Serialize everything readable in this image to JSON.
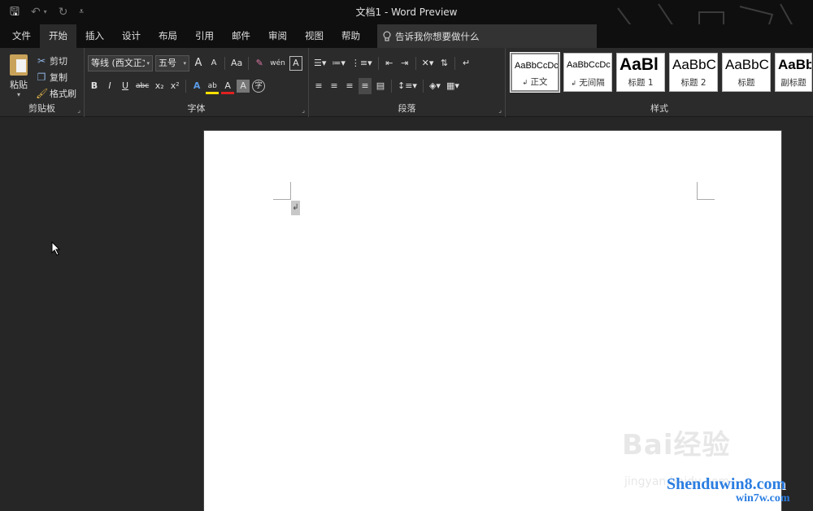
{
  "window": {
    "title": "文档1 - Word Preview"
  },
  "qat": {
    "save": "🖫",
    "undo": "↶",
    "undo_arrow": "▾",
    "redo": "↻",
    "customize": "⩡"
  },
  "tabs": [
    {
      "label": "文件"
    },
    {
      "label": "开始"
    },
    {
      "label": "插入"
    },
    {
      "label": "设计"
    },
    {
      "label": "布局"
    },
    {
      "label": "引用"
    },
    {
      "label": "邮件"
    },
    {
      "label": "审阅"
    },
    {
      "label": "视图"
    },
    {
      "label": "帮助"
    }
  ],
  "tellme": {
    "label": "告诉我你想要做什么"
  },
  "clipboard": {
    "group_label": "剪贴板",
    "paste": "粘贴",
    "cut": "剪切",
    "copy": "复制",
    "format_painter": "格式刷"
  },
  "font": {
    "group_label": "字体",
    "name": "等线 (西文正文",
    "size": "五号",
    "grow": "A",
    "shrink": "A",
    "case": "Aa",
    "phonetic": "wén",
    "border": "A",
    "bold": "B",
    "italic": "I",
    "underline": "U",
    "strike": "abc",
    "sub": "x₂",
    "sup": "x²",
    "effects": "A",
    "highlight": "ab",
    "color": "A",
    "shade": "A",
    "enclose": "字"
  },
  "paragraph": {
    "group_label": "段落"
  },
  "styles": {
    "group_label": "样式",
    "items": [
      {
        "preview": "AaBbCcDc",
        "name": "正文",
        "mark": "↲"
      },
      {
        "preview": "AaBbCcDc",
        "name": "无间隔",
        "mark": "↲"
      },
      {
        "preview": "AaBl",
        "name": "标题 1"
      },
      {
        "preview": "AaBbC",
        "name": "标题 2"
      },
      {
        "preview": "AaBbC",
        "name": "标题"
      },
      {
        "preview": "AaBb",
        "name": "副标题"
      }
    ]
  },
  "document": {
    "paragraph_mark": "↲"
  },
  "watermarks": {
    "baidu": "Bai经验",
    "jingyan": "jingyan.baidu.com",
    "site1": "Shenduwin8.com",
    "site2": "win7w.com"
  }
}
